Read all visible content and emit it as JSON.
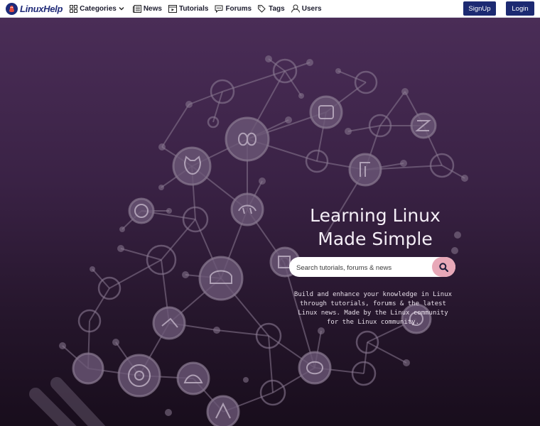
{
  "brand": {
    "name": "LinuxHelp"
  },
  "nav": {
    "items": [
      {
        "label": "Categories",
        "icon": "grid-icon"
      },
      {
        "label": "News",
        "icon": "newspaper-icon"
      },
      {
        "label": "Tutorials",
        "icon": "video-icon"
      },
      {
        "label": "Forums",
        "icon": "chat-icon"
      },
      {
        "label": "Tags",
        "icon": "tags-icon"
      },
      {
        "label": "Users",
        "icon": "user-icon"
      }
    ],
    "signup_label": "SignUp",
    "login_label": "Login"
  },
  "hero": {
    "title_line1": "Learning Linux",
    "title_line2": "Made Simple",
    "search_placeholder": "Search tutorials, forums & news",
    "description": "Build and enhance your knowledge in Linux through tutorials, forums & the latest Linux news. Made by the Linux community for the Linux community."
  },
  "colors": {
    "brand_navy": "#1c2a72",
    "hero_top": "#4a2d57",
    "hero_bottom": "#180d1c",
    "search_button": "#e8a8b8"
  }
}
